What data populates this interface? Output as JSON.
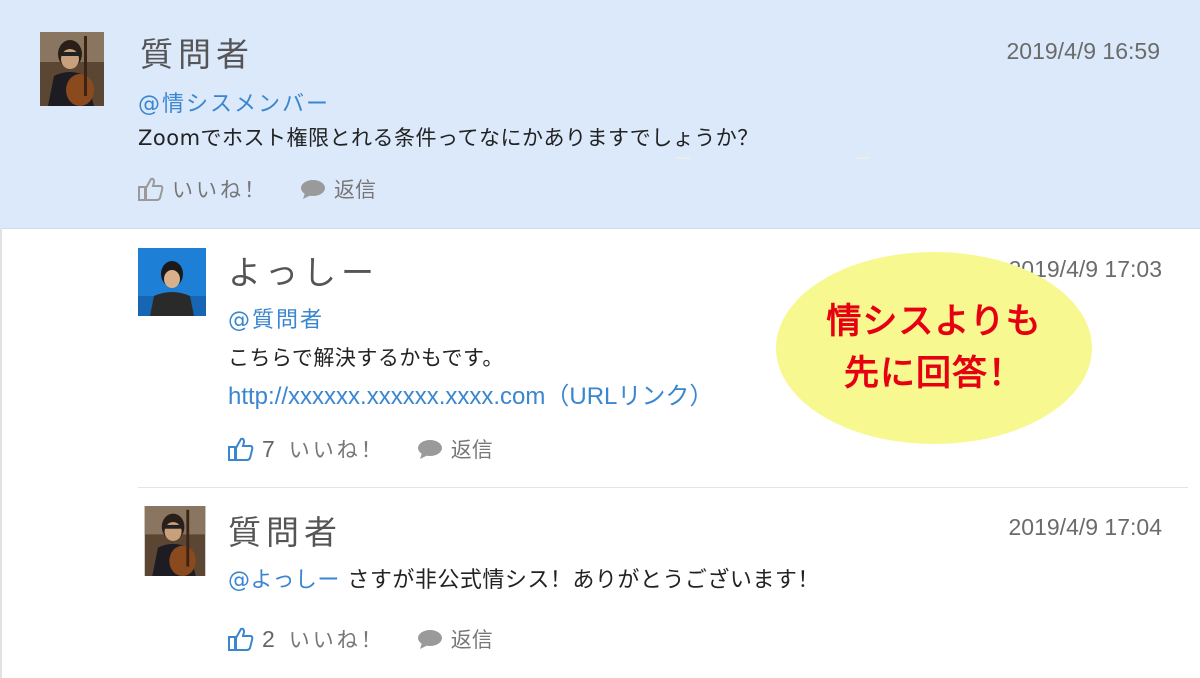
{
  "posts": [
    {
      "author": "質問者",
      "timestamp": "2019/4/9 16:59",
      "mention": "@情シスメンバー",
      "body": "Zoomでホスト権限とれる条件ってなにかありますでしょうか？",
      "like_label": "いいね！",
      "reply_label": "返信"
    },
    {
      "author": "よっしー",
      "timestamp": "2019/4/9 17:03",
      "mention": "@質問者",
      "body": "こちらで解決するかもです。",
      "link": "http://xxxxxx.xxxxxx.xxxx.com（URLリンク）",
      "like_count": "7",
      "like_label": "いいね！",
      "reply_label": "返信"
    },
    {
      "author": "質問者",
      "timestamp": "2019/4/9 17:04",
      "mention": "@よっしー",
      "body": "さすが非公式情シス！ありがとうございます！",
      "like_count": "2",
      "like_label": "いいね！",
      "reply_label": "返信"
    }
  ],
  "callout": {
    "line1": "情シスよりも",
    "line2": "先に回答！"
  },
  "colors": {
    "question_bg": "#dbe9fb",
    "mention": "#3a86cf",
    "callout_bg": "#f7f890",
    "callout_text": "#e60012"
  },
  "icons": {
    "like": "thumbs-up-icon",
    "reply": "speech-bubble-icon"
  }
}
